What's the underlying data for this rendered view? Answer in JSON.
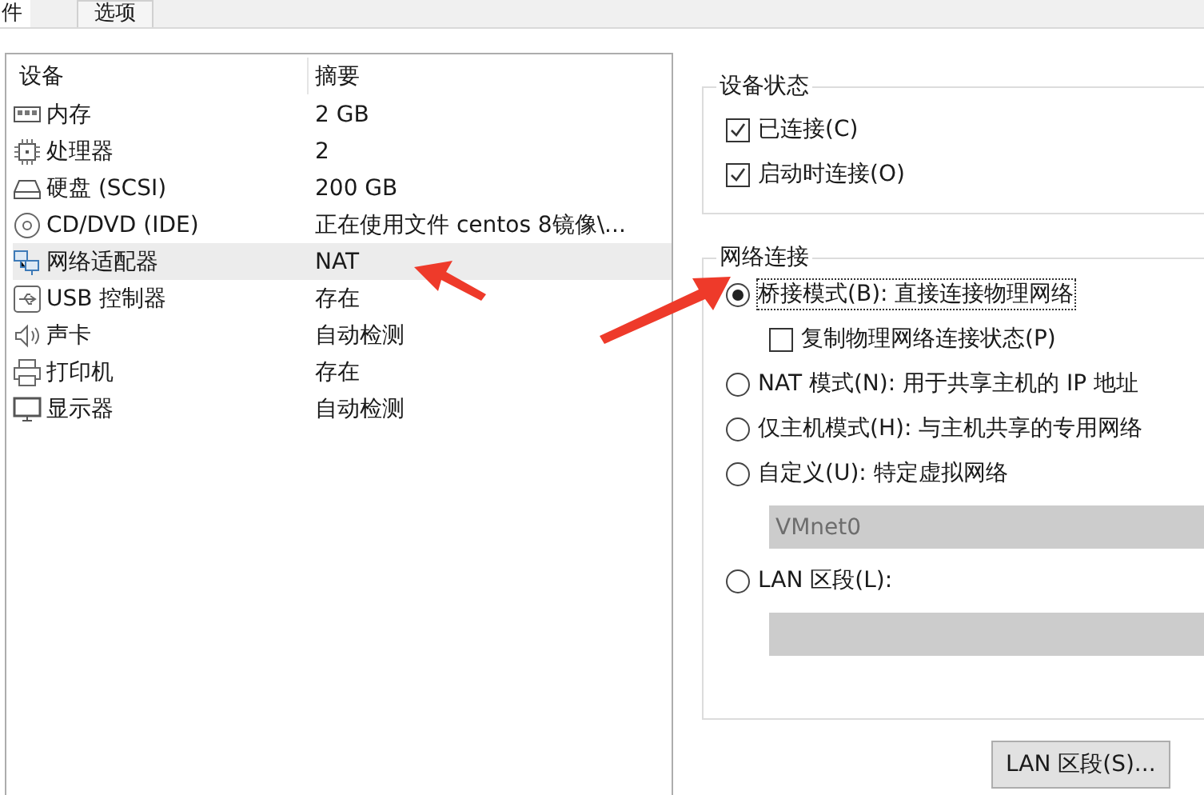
{
  "tabs": [
    {
      "label": "件",
      "selected": true
    },
    {
      "label": "选项",
      "selected": false
    }
  ],
  "devices": {
    "columns": [
      "设备",
      "摘要"
    ],
    "rows": [
      {
        "kind": "memory",
        "name": "内存",
        "summary": "2 GB",
        "selected": false
      },
      {
        "kind": "cpu",
        "name": "处理器",
        "summary": "2",
        "selected": false
      },
      {
        "kind": "disk",
        "name": "硬盘 (SCSI)",
        "summary": "200 GB",
        "selected": false
      },
      {
        "kind": "cd",
        "name": "CD/DVD (IDE)",
        "summary": "正在使用文件 centos 8镜像\\...",
        "selected": false
      },
      {
        "kind": "network",
        "name": "网络适配器",
        "summary": "NAT",
        "selected": true
      },
      {
        "kind": "usb",
        "name": "USB 控制器",
        "summary": "存在",
        "selected": false
      },
      {
        "kind": "sound",
        "name": "声卡",
        "summary": "自动检测",
        "selected": false
      },
      {
        "kind": "printer",
        "name": "打印机",
        "summary": "存在",
        "selected": false
      },
      {
        "kind": "display",
        "name": "显示器",
        "summary": "自动检测",
        "selected": false
      }
    ]
  },
  "device_status": {
    "title": "设备状态",
    "options": [
      {
        "label": "已连接(C)",
        "checked": true
      },
      {
        "label": "启动时连接(O)",
        "checked": true
      }
    ]
  },
  "network_connection": {
    "title": "网络连接",
    "items": [
      {
        "kind": "radio",
        "label": "桥接模式(B): 直接连接物理网络",
        "selected": true,
        "focused": true
      },
      {
        "kind": "checkbox",
        "label": "复制物理网络连接状态(P)",
        "checked": false
      },
      {
        "kind": "radio",
        "label": "NAT 模式(N): 用于共享主机的 IP 地址",
        "selected": false
      },
      {
        "kind": "radio",
        "label": "仅主机模式(H): 与主机共享的专用网络",
        "selected": false
      },
      {
        "kind": "radio",
        "label": "自定义(U): 特定虚拟网络",
        "selected": false
      },
      {
        "kind": "select",
        "value": "VMnet0",
        "disabled": true
      },
      {
        "kind": "radio",
        "label": "LAN 区段(L):",
        "selected": false
      },
      {
        "kind": "select",
        "disabled": true
      }
    ]
  },
  "buttons": [
    "LAN 区段(S)..."
  ],
  "annotations": [
    {
      "kind": "arrow",
      "color": "#ee3a2a"
    },
    {
      "kind": "arrow",
      "color": "#ee3a2a"
    }
  ]
}
